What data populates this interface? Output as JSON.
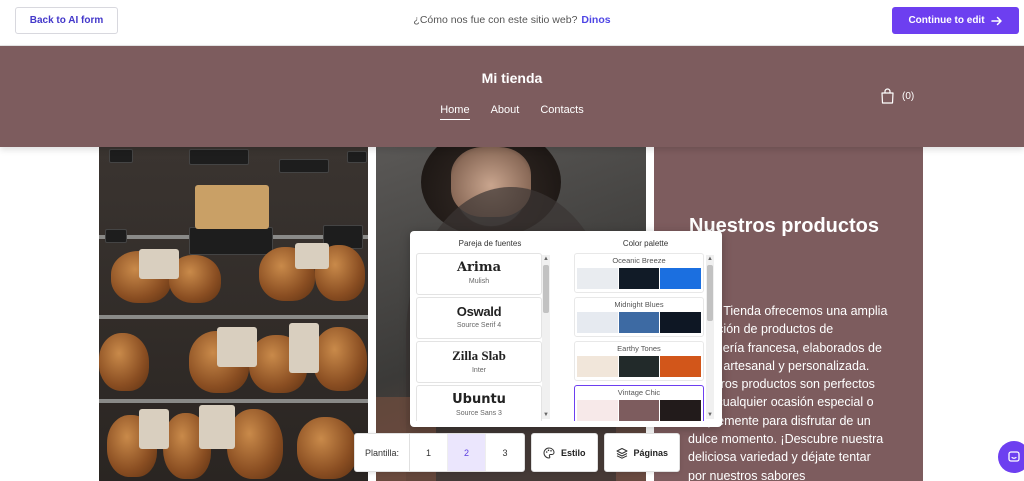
{
  "topbar": {
    "back_label": "Back to AI form",
    "feedback_question": "¿Cómo nos fue con este sitio web?",
    "feedback_link": "Dinos",
    "continue_label": "Continue to edit"
  },
  "site": {
    "title": "Mi tienda",
    "nav": [
      "Home",
      "About",
      "Contacts"
    ],
    "active_nav": "Home",
    "cart_count": "(0)"
  },
  "panel": {
    "heading": "Nuestros productos",
    "body": "En Mi Tienda ofrecemos una amplia selección de productos de panadería francesa, elaborados de forma artesanal y personalizada. Nuestros productos son perfectos para cualquier ocasión especial o simplemente para disfrutar de un dulce momento. ¡Descubre nuestra deliciosa variedad y déjate tentar por nuestros sabores"
  },
  "theme_picker": {
    "fonts_title": "Pareja de fuentes",
    "palette_title": "Color palette",
    "font_pairs": [
      {
        "name": "Arima",
        "sub": "Mulish"
      },
      {
        "name": "Oswald",
        "sub": "Source Serif 4"
      },
      {
        "name": "Zilla Slab",
        "sub": "Inter"
      },
      {
        "name": "Ubuntu",
        "sub": "Source Sans 3"
      }
    ],
    "palettes": [
      {
        "name": "Oceanic Breeze",
        "colors": [
          "#e9ecf0",
          "#111b27",
          "#1b6fe0"
        ]
      },
      {
        "name": "Midnight Blues",
        "colors": [
          "#e6eaf0",
          "#3d6aa3",
          "#0e1724"
        ]
      },
      {
        "name": "Earthy Tones",
        "colors": [
          "#f1e6da",
          "#222a2a",
          "#d2561a"
        ]
      },
      {
        "name": "Vintage Chic",
        "colors": [
          "#f7e9e9",
          "#7d5c5e",
          "#221b1b"
        ]
      }
    ],
    "selected_palette": "Vintage Chic"
  },
  "toolbar": {
    "template_label": "Plantilla:",
    "templates": [
      "1",
      "2",
      "3"
    ],
    "active_template": "2",
    "style_label": "Estilo",
    "pages_label": "Páginas"
  },
  "colors": {
    "accent": "#6d3ff0",
    "header_bg": "#7d5c5e"
  }
}
